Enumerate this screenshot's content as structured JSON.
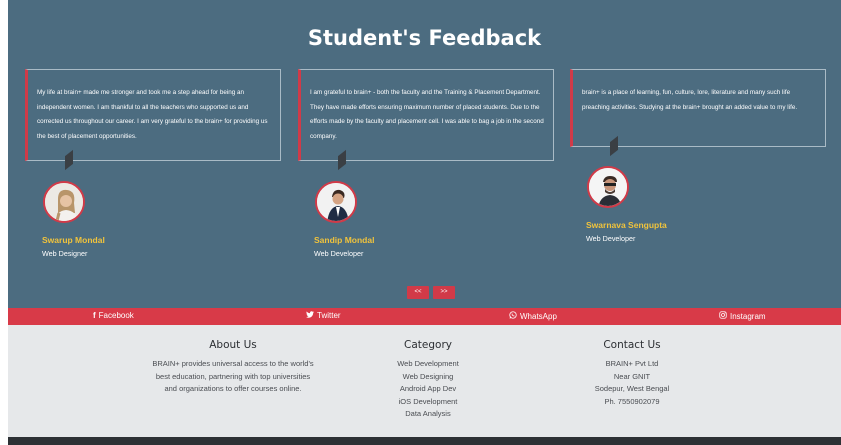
{
  "feedback": {
    "title": "Student's Feedback",
    "cards": [
      {
        "text": "My life at brain+ made me stronger and took me a step ahead for being an independent women. I am thankful to all the teachers who supported us and corrected us throughout our career. I am very grateful to the brain+ for providing us the best of placement opportunities.",
        "name": "Swarup Mondal",
        "role": "Web Designer"
      },
      {
        "text": "I am grateful to brain+ - both the faculty and the Training & Placement Department. They have made efforts ensuring maximum number of placed students. Due to the efforts made by the faculty and placement cell. I was able to bag a job in the second company.",
        "name": "Sandip Mondal",
        "role": "Web Developer"
      },
      {
        "text": "brain+ is a place of learning, fun, culture, lore, literature and many such life preaching activities. Studying at the brain+ brought an added value to my life.",
        "name": "Swarnava Sengupta",
        "role": "Web Developer"
      }
    ],
    "pager": {
      "prev": "<<",
      "next": ">>"
    }
  },
  "social": [
    {
      "icon": "facebook-icon",
      "glyph": "f",
      "label": "Facebook"
    },
    {
      "icon": "twitter-icon",
      "glyph": "🐦",
      "label": "Twitter"
    },
    {
      "icon": "whatsapp-icon",
      "glyph": "◌",
      "label": "WhatsApp"
    },
    {
      "icon": "instagram-icon",
      "glyph": "◎",
      "label": "Instagram"
    }
  ],
  "footer": {
    "about": {
      "title": "About Us",
      "text": [
        "BRAIN+ provides universal access to the world's",
        "best education, partnering with top universities",
        "and organizations to offer courses online."
      ]
    },
    "category": {
      "title": "Category",
      "items": [
        "Web Development",
        "Web Designing",
        "Android App Dev",
        "iOS Development",
        "Data Analysis"
      ]
    },
    "contact": {
      "title": "Contact Us",
      "lines": [
        "BRAIN+ Pvt Ltd",
        "Near GNIT",
        "Sodepur, West Bengal",
        "Ph. 7550902079"
      ]
    }
  },
  "colors": {
    "section_bg": "#4c6c80",
    "accent_red": "#d83a48",
    "name_yellow": "#f0c33c",
    "footer_bg": "#e6e8ea"
  }
}
